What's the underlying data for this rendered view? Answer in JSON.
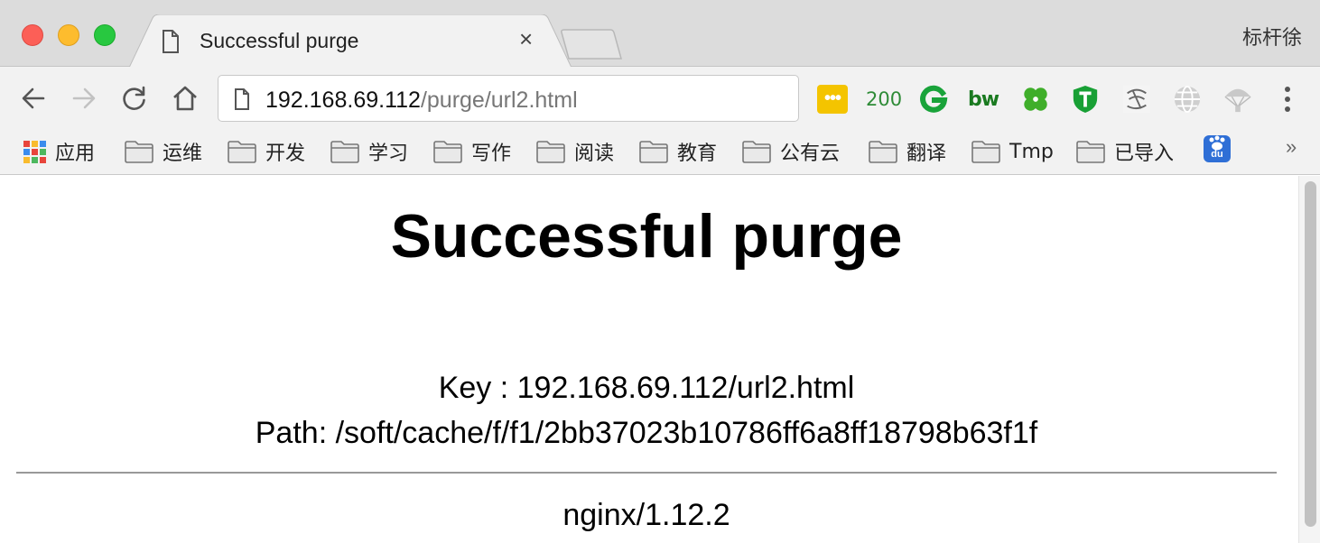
{
  "window": {
    "profile_name": "标杆徐"
  },
  "tab": {
    "title": "Successful purge",
    "close_glyph": "×"
  },
  "address_bar": {
    "host": "192.168.69.112",
    "path": "/purge/url2.html"
  },
  "extensions": [
    {
      "name": "lastpass-icon",
      "text": "•••"
    },
    {
      "name": "status-200-badge",
      "text": "200"
    },
    {
      "name": "g-icon"
    },
    {
      "name": "bw-icon",
      "text": "bw"
    },
    {
      "name": "clover-icon"
    },
    {
      "name": "shield-icon"
    },
    {
      "name": "swirl-icon"
    },
    {
      "name": "globe-icon"
    },
    {
      "name": "parachute-icon"
    }
  ],
  "bookmarks": {
    "apps_label": "应用",
    "folders": [
      "运维",
      "开发",
      "学习",
      "写作",
      "阅读",
      "教育",
      "公有云",
      "翻译",
      "Tmp",
      "已导入"
    ],
    "baidu_label": "du",
    "overflow_glyph": "»"
  },
  "page": {
    "heading": "Successful purge",
    "key_line": "Key : 192.168.69.112/url2.html",
    "path_line": "Path: /soft/cache/f/f1/2bb37023b10786ff6a8ff18798b63f1f",
    "server": "nginx/1.12.2"
  },
  "colors": {
    "close": "#fc5f57",
    "minimize": "#fdbc2e",
    "maximize": "#28c840",
    "lastpass": "#f4c400",
    "extension_green": "#2e8b37"
  }
}
